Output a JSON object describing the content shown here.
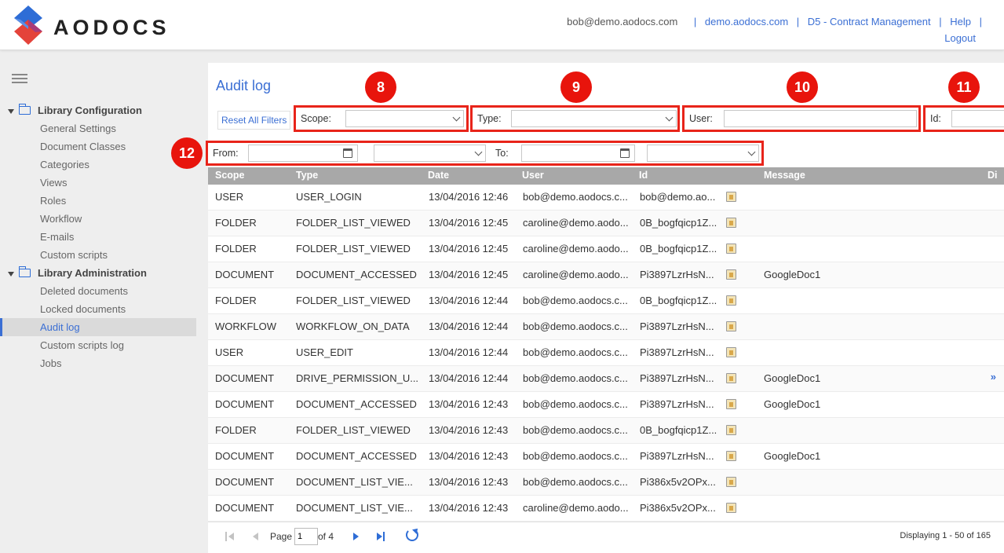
{
  "header": {
    "brand": "AODOCS",
    "user_email": "bob@demo.aodocs.com",
    "links": [
      "demo.aodocs.com",
      "D5 - Contract Management",
      "Help"
    ],
    "logout": "Logout",
    "colors": {
      "link": "#3b6fd4",
      "logo_blue": "#2e6dd6",
      "logo_red": "#e4433a"
    }
  },
  "sidebar": {
    "sections": [
      {
        "title": "Library Configuration",
        "items": [
          "General Settings",
          "Document Classes",
          "Categories",
          "Views",
          "Roles",
          "Workflow",
          "E-mails",
          "Custom scripts"
        ]
      },
      {
        "title": "Library Administration",
        "items": [
          "Deleted documents",
          "Locked documents",
          "Audit log",
          "Custom scripts log",
          "Jobs"
        ]
      }
    ],
    "active_item": "Audit log"
  },
  "main": {
    "title": "Audit log",
    "reset_label": "Reset All Filters",
    "filters": {
      "scope_label": "Scope:",
      "type_label": "Type:",
      "user_label": "User:",
      "id_label": "Id:",
      "from_label": "From:",
      "to_label": "To:"
    },
    "callouts": [
      "8",
      "9",
      "10",
      "11",
      "12"
    ],
    "callout_color": "#e8241a",
    "table": {
      "columns": [
        "Scope",
        "Type",
        "Date",
        "User",
        "Id",
        "Message",
        "Di"
      ],
      "rows": [
        [
          "USER",
          "USER_LOGIN",
          "13/04/2016 12:46",
          "bob@demo.aodocs.c...",
          "bob@demo.ao...",
          ""
        ],
        [
          "FOLDER",
          "FOLDER_LIST_VIEWED",
          "13/04/2016 12:45",
          "caroline@demo.aodo...",
          "0B_bogfqicp1Z...",
          ""
        ],
        [
          "FOLDER",
          "FOLDER_LIST_VIEWED",
          "13/04/2016 12:45",
          "caroline@demo.aodo...",
          "0B_bogfqicp1Z...",
          ""
        ],
        [
          "DOCUMENT",
          "DOCUMENT_ACCESSED",
          "13/04/2016 12:45",
          "caroline@demo.aodo...",
          "Pi3897LzrHsN...",
          "GoogleDoc1"
        ],
        [
          "FOLDER",
          "FOLDER_LIST_VIEWED",
          "13/04/2016 12:44",
          "bob@demo.aodocs.c...",
          "0B_bogfqicp1Z...",
          ""
        ],
        [
          "WORKFLOW",
          "WORKFLOW_ON_DATA",
          "13/04/2016 12:44",
          "bob@demo.aodocs.c...",
          "Pi3897LzrHsN...",
          ""
        ],
        [
          "USER",
          "USER_EDIT",
          "13/04/2016 12:44",
          "bob@demo.aodocs.c...",
          "Pi3897LzrHsN...",
          ""
        ],
        [
          "DOCUMENT",
          "DRIVE_PERMISSION_U...",
          "13/04/2016 12:44",
          "bob@demo.aodocs.c...",
          "Pi3897LzrHsN...",
          "GoogleDoc1"
        ],
        [
          "DOCUMENT",
          "DOCUMENT_ACCESSED",
          "13/04/2016 12:43",
          "bob@demo.aodocs.c...",
          "Pi3897LzrHsN...",
          "GoogleDoc1"
        ],
        [
          "FOLDER",
          "FOLDER_LIST_VIEWED",
          "13/04/2016 12:43",
          "bob@demo.aodocs.c...",
          "0B_bogfqicp1Z...",
          ""
        ],
        [
          "DOCUMENT",
          "DOCUMENT_ACCESSED",
          "13/04/2016 12:43",
          "bob@demo.aodocs.c...",
          "Pi3897LzrHsN...",
          "GoogleDoc1"
        ],
        [
          "DOCUMENT",
          "DOCUMENT_LIST_VIE...",
          "13/04/2016 12:43",
          "bob@demo.aodocs.c...",
          "Pi386x5v2OPx...",
          ""
        ],
        [
          "DOCUMENT",
          "DOCUMENT_LIST_VIE...",
          "13/04/2016 12:43",
          "caroline@demo.aodo...",
          "Pi386x5v2OPx...",
          ""
        ]
      ],
      "more_marker": "»"
    },
    "pager": {
      "page_label": "Page",
      "page_value": "1",
      "of_label": "of 4",
      "display_text": "Displaying 1 - 50 of 165"
    }
  }
}
